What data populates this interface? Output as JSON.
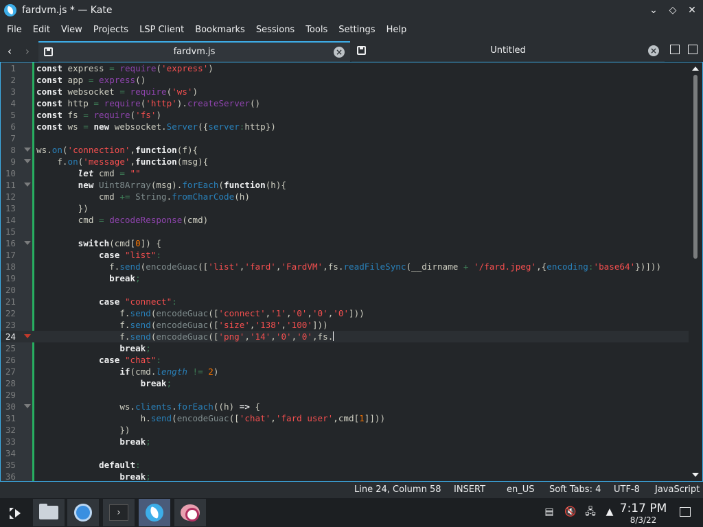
{
  "window": {
    "title": "fardvm.js * — Kate",
    "minimize_glyph": "⌄",
    "maximize_glyph": "◇",
    "close_glyph": "✕"
  },
  "menu": [
    "File",
    "Edit",
    "View",
    "Projects",
    "LSP Client",
    "Bookmarks",
    "Sessions",
    "Tools",
    "Settings",
    "Help"
  ],
  "tabs": {
    "back_glyph": "‹",
    "forward_glyph": "›",
    "active": {
      "label": "fardvm.js",
      "close": "×"
    },
    "inactive": {
      "label": "Untitled",
      "close": "×"
    }
  },
  "editor": {
    "language": "JavaScript",
    "current_line": 24,
    "line_numbers": [
      "1",
      "2",
      "3",
      "4",
      "5",
      "6",
      "7",
      "8",
      "9",
      "10",
      "11",
      "12",
      "13",
      "14",
      "15",
      "16",
      "17",
      "18",
      "19",
      "20",
      "21",
      "22",
      "23",
      "24",
      "25",
      "26",
      "27",
      "28",
      "29",
      "30",
      "31",
      "32",
      "33",
      "34",
      "35",
      "36"
    ]
  },
  "status": {
    "position": "Line 24, Column 58",
    "mode": "INSERT",
    "dictionary": "en_US",
    "indent": "Soft Tabs: 4",
    "encoding": "UTF-8",
    "syntax": "JavaScript"
  },
  "taskbar": {
    "terminal_glyph": "›",
    "tray": {
      "clipboard": "▤",
      "volume": "🔇",
      "network": "🖧",
      "expand": "▲"
    },
    "clock_time": "7:17 PM",
    "clock_date": "8/3/22"
  },
  "colors": {
    "accent": "#3daee9",
    "background": "#232629",
    "string": "#f44f4f",
    "function": "#8e44ad",
    "number": "#f67400",
    "property": "#2980b9",
    "operator": "#3f8058",
    "modified_line_marker": "#27ae60"
  }
}
